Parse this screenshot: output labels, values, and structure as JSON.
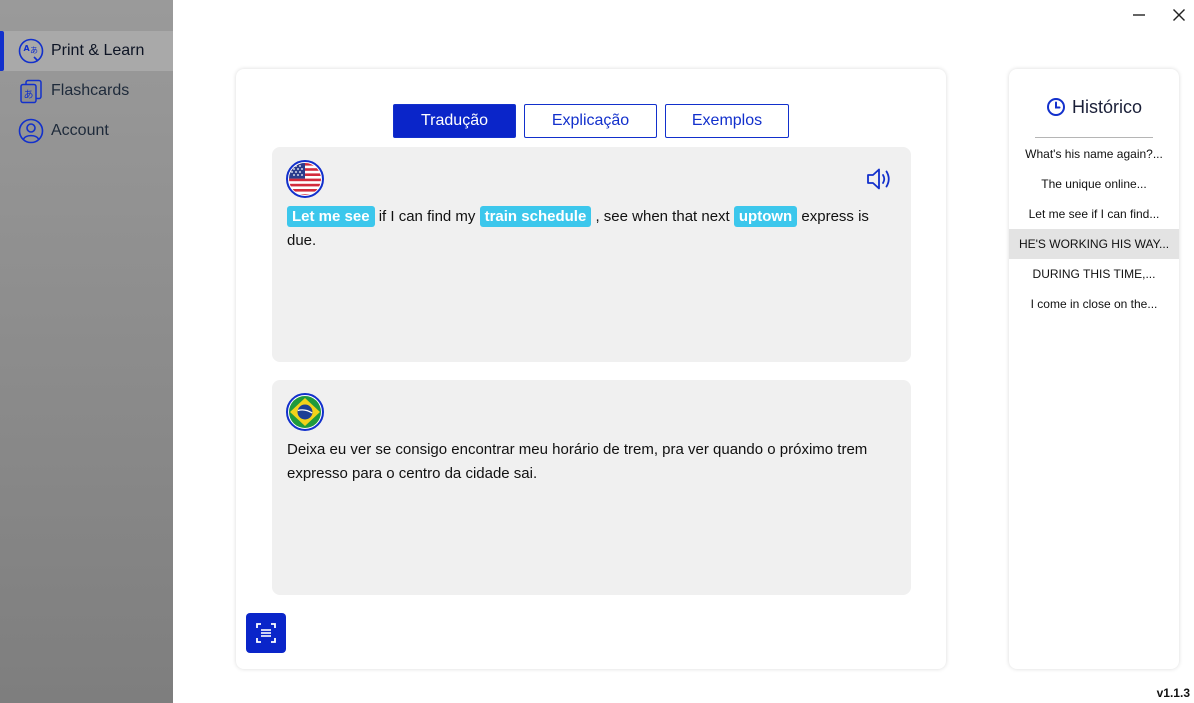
{
  "sidebar": {
    "items": [
      {
        "label": "Print & Learn",
        "icon": "translate-icon",
        "active": true
      },
      {
        "label": "Flashcards",
        "icon": "flashcards-icon",
        "active": false
      },
      {
        "label": "Account",
        "icon": "user-icon",
        "active": false
      }
    ]
  },
  "window": {
    "minimize_icon": "minimize-icon",
    "close_icon": "close-icon"
  },
  "tabs": [
    {
      "label": "Tradução",
      "active": true
    },
    {
      "label": "Explicação",
      "active": false
    },
    {
      "label": "Exemplos",
      "active": false
    }
  ],
  "source": {
    "flag": "us-flag-icon",
    "segments": [
      {
        "text": "Let me see",
        "highlight": true
      },
      {
        "text": " if I can find my ",
        "highlight": false
      },
      {
        "text": "train schedule",
        "highlight": true
      },
      {
        "text": " , see when that next ",
        "highlight": false
      },
      {
        "text": "uptown",
        "highlight": true
      },
      {
        "text": " express is due.",
        "highlight": false
      }
    ]
  },
  "translation": {
    "flag": "brazil-flag-icon",
    "text": "Deixa eu ver se consigo encontrar meu horário de trem, pra ver quando o próximo trem expresso para o centro da cidade sai."
  },
  "history": {
    "title": "Histórico",
    "items": [
      {
        "text": "What's his name again?...",
        "selected": false
      },
      {
        "text": "The unique online...",
        "selected": false
      },
      {
        "text": "Let me see if I can find...",
        "selected": false
      },
      {
        "text": "HE'S WORKING HIS WAY...",
        "selected": true
      },
      {
        "text": "DURING THIS TIME,...",
        "selected": false
      },
      {
        "text": "I come in close on the...",
        "selected": false
      }
    ]
  },
  "version": "v1.1.3",
  "colors": {
    "accent": "#0a25c9",
    "highlight": "#3cc7ec",
    "panel_bg": "#f0f0f0"
  }
}
